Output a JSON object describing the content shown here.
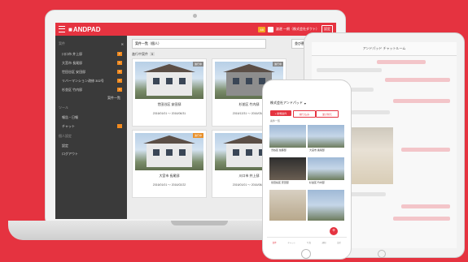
{
  "brand": {
    "name": "ANDPAD",
    "accent": "#e53340"
  },
  "header": {
    "user": "渡邊 一朗（株式会社ダクト）",
    "chip": "48",
    "logout": "設定"
  },
  "sidebar": {
    "section1": "案件",
    "items": [
      {
        "label": "川口市 井上邸",
        "badge": "2"
      },
      {
        "label": "大宮市 長尾邸",
        "badge": "1"
      },
      {
        "label": "世田谷区 安田邸",
        "badge": "3"
      },
      {
        "label": "リバーマンション改修 302号",
        "badge": "1"
      },
      {
        "label": "杉並区 竹内邸",
        "badge": "1"
      }
    ],
    "more": "案件一覧",
    "section2": "ツール",
    "tools": [
      "報告・日報",
      "チャット"
    ],
    "section3": "個人設定",
    "settings": [
      "設定",
      "ログアウト"
    ]
  },
  "main": {
    "breadcrumb": "案件一覧（個人）",
    "filter_button": "並び替え",
    "section_label": "進行中案件",
    "count": "5",
    "cards": [
      {
        "name": "世田谷区 安田邸",
        "date": "2016/01/01 〜 2016/06/31",
        "tag": "進行中"
      },
      {
        "name": "杉並区 竹内邸",
        "date": "2016/12/31 〜 2016/03/15",
        "tag": "進行中"
      },
      {
        "name": "大宮市 長尾邸",
        "date": "2016/01/01 〜 2016/02/22",
        "tag": "進行中"
      },
      {
        "name": "川口市 井上邸",
        "date": "2016/01/01 〜 2016/06/30",
        "tag": "進行中"
      }
    ]
  },
  "tablet": {
    "title": "アンドパッド チャットルーム"
  },
  "phone": {
    "company": "株式会社アンドパッド",
    "btn_new": "+ 新規案件",
    "btn_filter": "絞り込み",
    "btn_sort": "並び替え",
    "list_label": "案件一覧",
    "items": [
      "渋谷区 佐藤邸",
      "大宮市 長尾邸",
      "世田谷区 安田邸",
      "杉並区 竹内邸"
    ],
    "tabs": [
      "案件",
      "チャット",
      "写真",
      "通知",
      "設定"
    ]
  }
}
